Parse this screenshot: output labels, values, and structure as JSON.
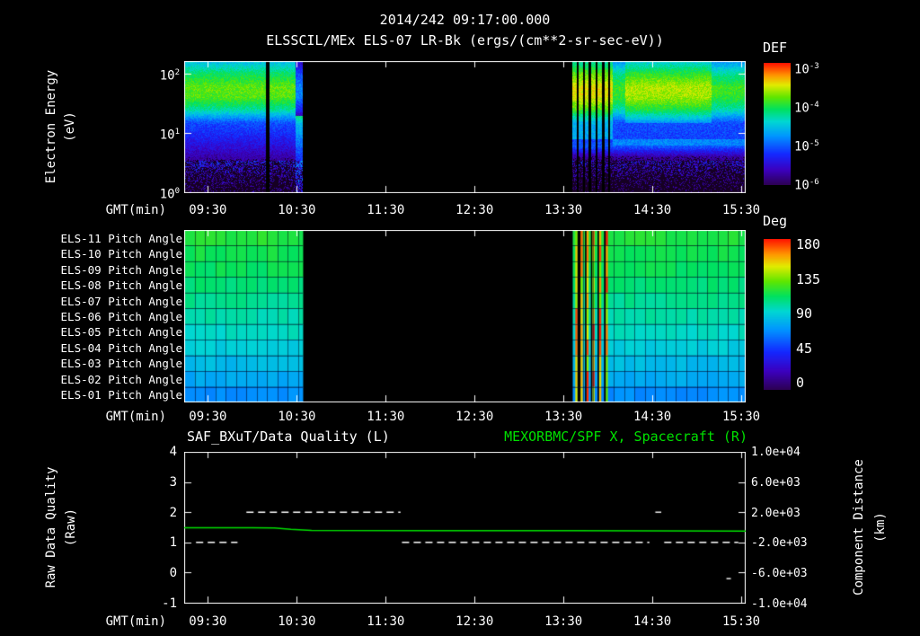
{
  "colors": {
    "background": "#000000",
    "text": "#ffffff",
    "accent_green": "#00e000",
    "axis": "#ffffff"
  },
  "header": {
    "timestamp": "2014/242 09:17:00.000",
    "title": "ELSSCIL/MEx ELS-07 LR-Bk (ergs/(cm**2-sr-sec-eV))"
  },
  "time_axis": {
    "label": "GMT(min)",
    "ticks": [
      "09:30",
      "10:30",
      "11:30",
      "12:30",
      "13:30",
      "14:30",
      "15:30"
    ],
    "tick_minutes": [
      570,
      630,
      690,
      750,
      810,
      870,
      930
    ],
    "start_min": 554,
    "end_min": 933,
    "start_label": "09:14",
    "end_label": "15:33"
  },
  "chart_data": [
    {
      "type": "heatmap",
      "name": "electron-energy-spectrogram",
      "instrument": "ELSSCIL/MEx ELS-07 LR-Bk",
      "units": "ergs/(cm**2-sr-sec-eV)",
      "ylabel_line1": "Electron Energy",
      "ylabel_line2": "(eV)",
      "yscale": "log",
      "ylim_ev": [
        1,
        162
      ],
      "yticks": [
        {
          "base": "10",
          "exp": "2"
        },
        {
          "base": "10",
          "exp": "1"
        },
        {
          "base": "10",
          "exp": "0"
        }
      ],
      "colorbar": {
        "label": "DEF",
        "ticks": [
          {
            "base": "10",
            "exp": "-3"
          },
          {
            "base": "10",
            "exp": "-4"
          },
          {
            "base": "10",
            "exp": "-5"
          },
          {
            "base": "10",
            "exp": "-6"
          }
        ],
        "range_log10": [
          -6,
          -3
        ]
      },
      "segments": [
        {
          "kind": "data",
          "start_min": 554,
          "end_min": 634,
          "end_transition_min": 629,
          "profile_ev_log10def": [
            [
              162,
              -4.6
            ],
            [
              100,
              -4.15
            ],
            [
              60,
              -3.85
            ],
            [
              40,
              -3.9
            ],
            [
              25,
              -4.3
            ],
            [
              15,
              -5.1
            ],
            [
              8,
              -5.35
            ],
            [
              4,
              -5.7
            ],
            [
              2,
              -6.1
            ],
            [
              1,
              -6.4
            ]
          ]
        },
        {
          "kind": "gap",
          "start_min": 634,
          "end_min": 816
        },
        {
          "kind": "data",
          "start_min": 816,
          "end_min": 933,
          "profile_ev_log10def": [
            [
              162,
              -4.8
            ],
            [
              100,
              -4.3
            ],
            [
              60,
              -3.95
            ],
            [
              40,
              -4.0
            ],
            [
              25,
              -4.35
            ],
            [
              15,
              -5.1
            ],
            [
              8,
              -5.15
            ],
            [
              6,
              -5.05
            ],
            [
              4,
              -5.75
            ],
            [
              2,
              -6.2
            ],
            [
              1,
              -6.5
            ]
          ]
        }
      ],
      "dark_stripes_min": [
        [
          609,
          611.5
        ],
        [
          819,
          820.5
        ],
        [
          823,
          824.5
        ],
        [
          827,
          828.5
        ],
        [
          831.5,
          833
        ],
        [
          836,
          837.5
        ],
        [
          840,
          841.2
        ]
      ],
      "burst_zone_min": [
        816,
        843
      ],
      "bright_intervals_min": [
        [
          852,
          910
        ]
      ],
      "line_feature": {
        "energy_ev": 7,
        "from_min": 843,
        "log10def": -4.85
      }
    },
    {
      "type": "heatmap",
      "name": "pitch-angle-panels",
      "rows": [
        {
          "label": "ELS-11 Pitch Angle",
          "value_deg": 118
        },
        {
          "label": "ELS-10 Pitch Angle",
          "value_deg": 115
        },
        {
          "label": "ELS-09 Pitch Angle",
          "value_deg": 112
        },
        {
          "label": "ELS-08 Pitch Angle",
          "value_deg": 108
        },
        {
          "label": "ELS-07 Pitch Angle",
          "value_deg": 104
        },
        {
          "label": "ELS-06 Pitch Angle",
          "value_deg": 100
        },
        {
          "label": "ELS-05 Pitch Angle",
          "value_deg": 96
        },
        {
          "label": "ELS-04 Pitch Angle",
          "value_deg": 90
        },
        {
          "label": "ELS-03 Pitch Angle",
          "value_deg": 84
        },
        {
          "label": "ELS-02 Pitch Angle",
          "value_deg": 78
        },
        {
          "label": "ELS-01 Pitch Angle",
          "value_deg": 70
        }
      ],
      "colorbar": {
        "label": "Deg",
        "ticks": [
          "180",
          "135",
          "90",
          "45",
          "0"
        ],
        "range_deg": [
          0,
          180
        ]
      },
      "segments": [
        {
          "kind": "data",
          "start_min": 554,
          "end_min": 634
        },
        {
          "kind": "gap",
          "start_min": 634,
          "end_min": 816
        },
        {
          "kind": "data",
          "start_min": 816,
          "end_min": 933
        }
      ],
      "hot_stripes_min": [
        [
          818,
          819.5
        ],
        [
          821.5,
          823
        ],
        [
          825.5,
          827
        ],
        [
          829.5,
          831
        ],
        [
          834,
          835.5
        ],
        [
          838.5,
          840
        ]
      ],
      "dark_stripes_min": [
        [
          819.5,
          821.5
        ],
        [
          824.5,
          825.5
        ],
        [
          828.5,
          829.5
        ],
        [
          833,
          834
        ],
        [
          837.5,
          838.5
        ]
      ],
      "grid_minutes": 7
    },
    {
      "type": "line",
      "name": "quality-and-distance",
      "title_left": "SAF_BXuT/Data Quality (L)",
      "title_right": "MEXORBMC/SPF X, Spacecraft (R)",
      "left_axis": {
        "label_line1": "Raw Data Quality",
        "label_line2": "(Raw)",
        "ticks": [
          "4",
          "3",
          "2",
          "1",
          "0",
          "-1"
        ],
        "lim": [
          -1,
          4
        ]
      },
      "right_axis": {
        "label_line1": "Component Distance",
        "label_line2": "(km)",
        "ticks": [
          "1.0e+04",
          "6.0e+03",
          "2.0e+03",
          "-2.0e+03",
          "-6.0e+03",
          "-1.0e+04"
        ],
        "lim": [
          -10000,
          10000
        ]
      },
      "series": [
        {
          "name": "MEXORBMC/SPF X Spacecraft",
          "axis": "right",
          "color": "#00e000",
          "style": "solid",
          "points_min_km": [
            [
              554,
              -60
            ],
            [
              600,
              -70
            ],
            [
              615,
              -100
            ],
            [
              626,
              -280
            ],
            [
              640,
              -430
            ],
            [
              720,
              -450
            ],
            [
              816,
              -460
            ],
            [
              880,
              -470
            ],
            [
              933,
              -500
            ]
          ]
        },
        {
          "name": "SAF_BXuT Data Quality",
          "axis": "left",
          "color": "#ffffff",
          "style": "dashed",
          "segments_min_value": [
            [
              562,
              590,
              1
            ],
            [
              596,
              700,
              2
            ],
            [
              701,
              868,
              1
            ],
            [
              872,
              876,
              2
            ],
            [
              878,
              928,
              1
            ],
            [
              920,
              923,
              -0.2
            ]
          ]
        }
      ]
    }
  ]
}
